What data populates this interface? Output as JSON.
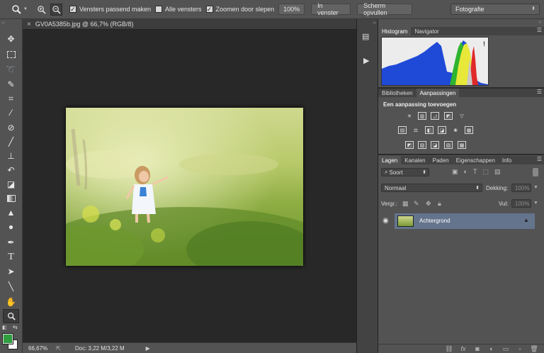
{
  "options_bar": {
    "zoom_tool_icon": "zoom-icon",
    "checkbox_fit_windows": {
      "label": "Vensters passend maken",
      "checked": true
    },
    "checkbox_all_windows": {
      "label": "Alle vensters",
      "checked": false
    },
    "checkbox_scrubby_zoom": {
      "label": "Zoomen door slepen",
      "checked": true
    },
    "button_100": "100%",
    "button_fit_screen": "In venster",
    "button_fill_screen": "Scherm opvullen",
    "workspace": "Fotografie"
  },
  "document": {
    "tab_title": "GV0A5385b.jpg @ 66,7% (RGB/8)",
    "close_glyph": "×"
  },
  "status_bar": {
    "zoom": "66,67%",
    "doc_info": "Doc: 3,22 M/3,22 M"
  },
  "panels": {
    "histogram_tabs": [
      "Histogram",
      "Navigator"
    ],
    "histogram_warning": "!",
    "adjust_tabs": [
      "Bibliotheken",
      "Aanpassingen"
    ],
    "adjust_title": "Een aanpassing toevoegen",
    "layers_tabs": [
      "Lagen",
      "Kanalen",
      "Paden",
      "Eigenschappen",
      "Info"
    ],
    "layers": {
      "filter_kind": "Soort",
      "blend_mode": "Normaal",
      "opacity_label": "Dekking:",
      "opacity_value": "100%",
      "lock_label": "Vergr.:",
      "fill_label": "Vul:",
      "fill_value": "100%",
      "layer_name": "Achtergrond"
    }
  },
  "colors": {
    "foreground": "#2e9e3e",
    "background": "#ffffff",
    "selected_layer": "#64748c"
  }
}
